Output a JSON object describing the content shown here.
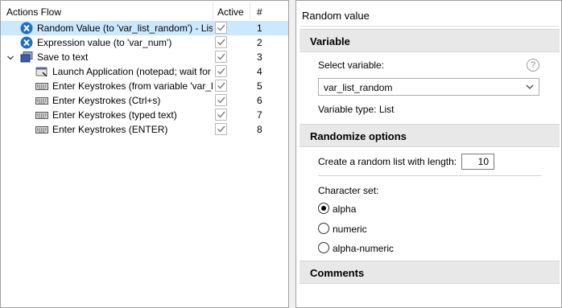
{
  "flow": {
    "headers": {
      "name": "Actions Flow",
      "active": "Active",
      "num": "#"
    },
    "rows": [
      {
        "label": "Random Value (to 'var_list_random') - List",
        "num": "1",
        "icon": "variable-x-icon",
        "active": true,
        "selected": true,
        "indent": 0
      },
      {
        "label": "Expression value (to 'var_num')",
        "num": "2",
        "icon": "variable-x-icon",
        "active": true,
        "selected": false,
        "indent": 0
      },
      {
        "label": "Save to text",
        "num": "3",
        "icon": "window-stack-icon",
        "active": true,
        "selected": false,
        "indent": 0,
        "expanded": true
      },
      {
        "label": "Launch Application (notepad; wait for",
        "num": "4",
        "icon": "launch-app-icon",
        "active": true,
        "selected": false,
        "indent": 1
      },
      {
        "label": "Enter Keystrokes (from variable 'var_lis",
        "num": "5",
        "icon": "keyboard-icon",
        "active": true,
        "selected": false,
        "indent": 1
      },
      {
        "label": "Enter Keystrokes (Ctrl+s)",
        "num": "6",
        "icon": "keyboard-icon",
        "active": true,
        "selected": false,
        "indent": 1
      },
      {
        "label": "Enter Keystrokes (typed text)",
        "num": "7",
        "icon": "keyboard-icon",
        "active": true,
        "selected": false,
        "indent": 1
      },
      {
        "label": "Enter Keystrokes (ENTER)",
        "num": "8",
        "icon": "keyboard-icon",
        "active": true,
        "selected": false,
        "indent": 1
      }
    ]
  },
  "panel": {
    "title": "Random value",
    "variable_section": "Variable",
    "select_label": "Select variable:",
    "help": "?",
    "select_value": "var_list_random",
    "variable_type": "Variable type: List",
    "randomize_section": "Randomize options",
    "length_label": "Create a random list with length:",
    "length_value": "10",
    "charset_label": "Character set:",
    "charset_options": [
      "alpha",
      "numeric",
      "alpha-numeric"
    ],
    "charset_selected": "alpha",
    "comments_section": "Comments"
  },
  "colors": {
    "selection": "#cce8ff",
    "x_icon": "#1c6fd1",
    "section_bg": "#e8e8e8"
  }
}
